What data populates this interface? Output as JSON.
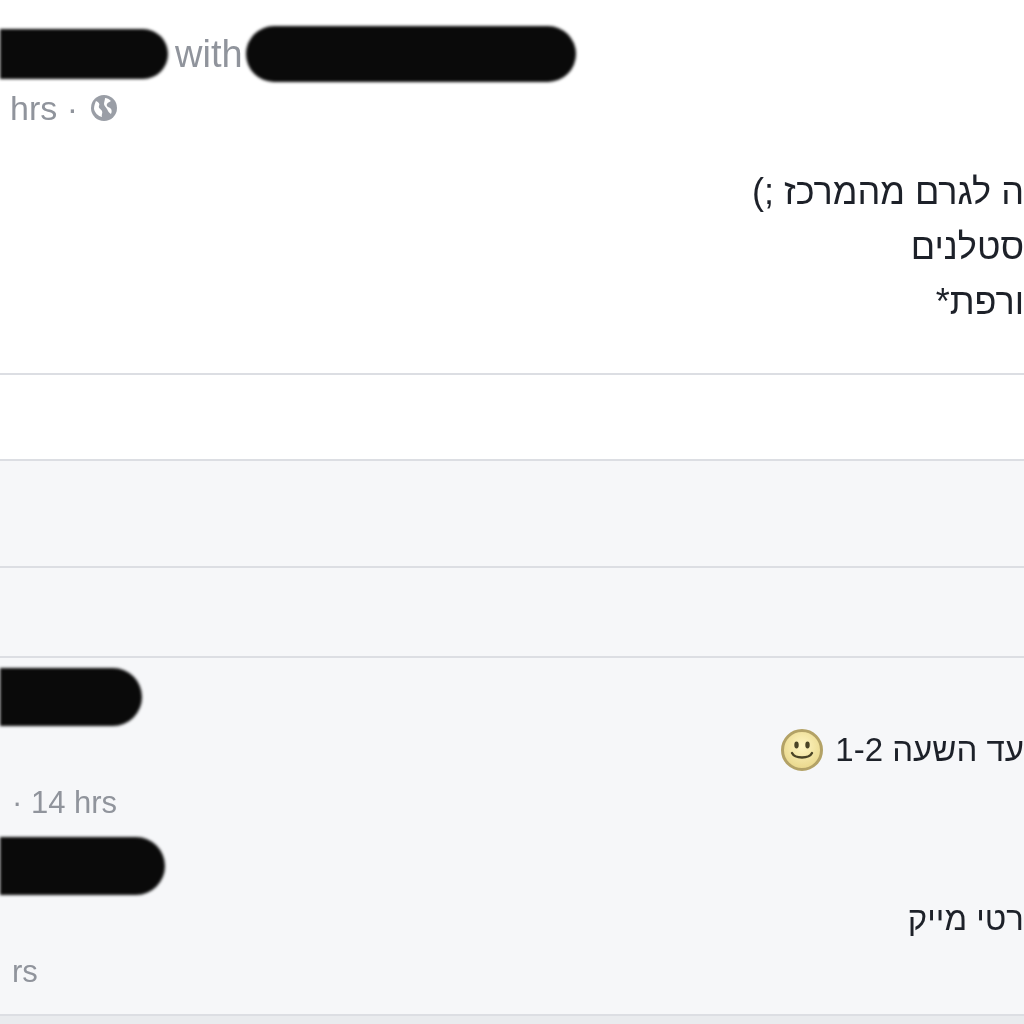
{
  "post": {
    "header": {
      "connector": "with",
      "timestamp": "hrs ·"
    },
    "body_lines": [
      "ה לגרם מהמרכז ;)",
      "סטלנים",
      "ורפת*"
    ]
  },
  "comments": [
    {
      "text": "עד השעה 1-2",
      "has_emoji": true,
      "meta": "· 14 hrs"
    },
    {
      "text": "רטי מייק",
      "has_emoji": false,
      "meta": "rs"
    }
  ]
}
